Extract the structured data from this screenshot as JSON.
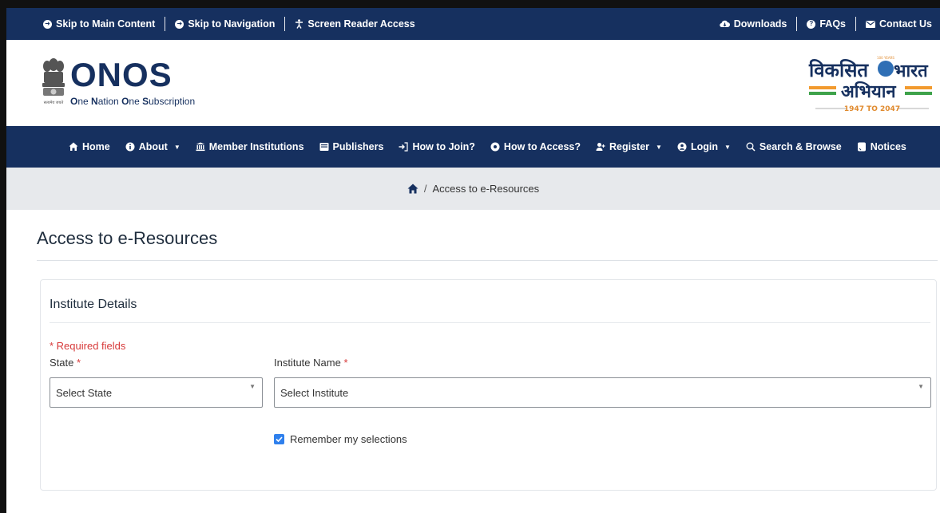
{
  "topbar": {
    "skip_main": "Skip to Main Content",
    "skip_nav": "Skip to Navigation",
    "screen_reader": "Screen Reader Access",
    "downloads": "Downloads",
    "faqs": "FAQs",
    "contact": "Contact Us"
  },
  "header": {
    "logo_main": "ONOS",
    "logo_sub_parts": [
      "O",
      "ne ",
      "N",
      "ation ",
      "O",
      "ne ",
      "S",
      "ubscription"
    ],
    "emblem_caption": "सत्यमेव जयते",
    "vb_line1": "विकसित",
    "vb_line1b": "भारत",
    "vb_line2": "अभियान",
    "vb_years": "1947 TO 2047",
    "vb_badge": "100 YEARS"
  },
  "nav": {
    "items": [
      {
        "label": "Home",
        "icon": "home-icon",
        "caret": false
      },
      {
        "label": "About",
        "icon": "info-icon",
        "caret": true
      },
      {
        "label": "Member Institutions",
        "icon": "institution-icon",
        "caret": false
      },
      {
        "label": "Publishers",
        "icon": "book-icon",
        "caret": false
      },
      {
        "label": "How to Join?",
        "icon": "sign-in-icon",
        "caret": false
      },
      {
        "label": "How to Access?",
        "icon": "gear-icon",
        "caret": false
      },
      {
        "label": "Register",
        "icon": "user-plus-icon",
        "caret": true
      },
      {
        "label": "Login",
        "icon": "login-icon",
        "caret": true
      },
      {
        "label": "Search & Browse",
        "icon": "search-icon",
        "caret": false
      },
      {
        "label": "Notices",
        "icon": "notice-icon",
        "caret": false
      }
    ]
  },
  "breadcrumb": {
    "sep": "/",
    "current": "Access to e-Resources"
  },
  "main": {
    "title": "Access to e-Resources",
    "card_title": "Institute Details",
    "required_note": "* Required fields",
    "state_label": "State",
    "institute_label": "Institute Name",
    "required_mark": "*",
    "state_value": "Select State",
    "institute_value": "Select Institute",
    "remember_label": "Remember my selections",
    "remember_checked": true
  },
  "colors": {
    "brand_navy": "#16305f",
    "required_red": "#d73a3a",
    "checkbox_blue": "#2f80ed",
    "breadcrumb_bg": "#e7e9ec"
  }
}
